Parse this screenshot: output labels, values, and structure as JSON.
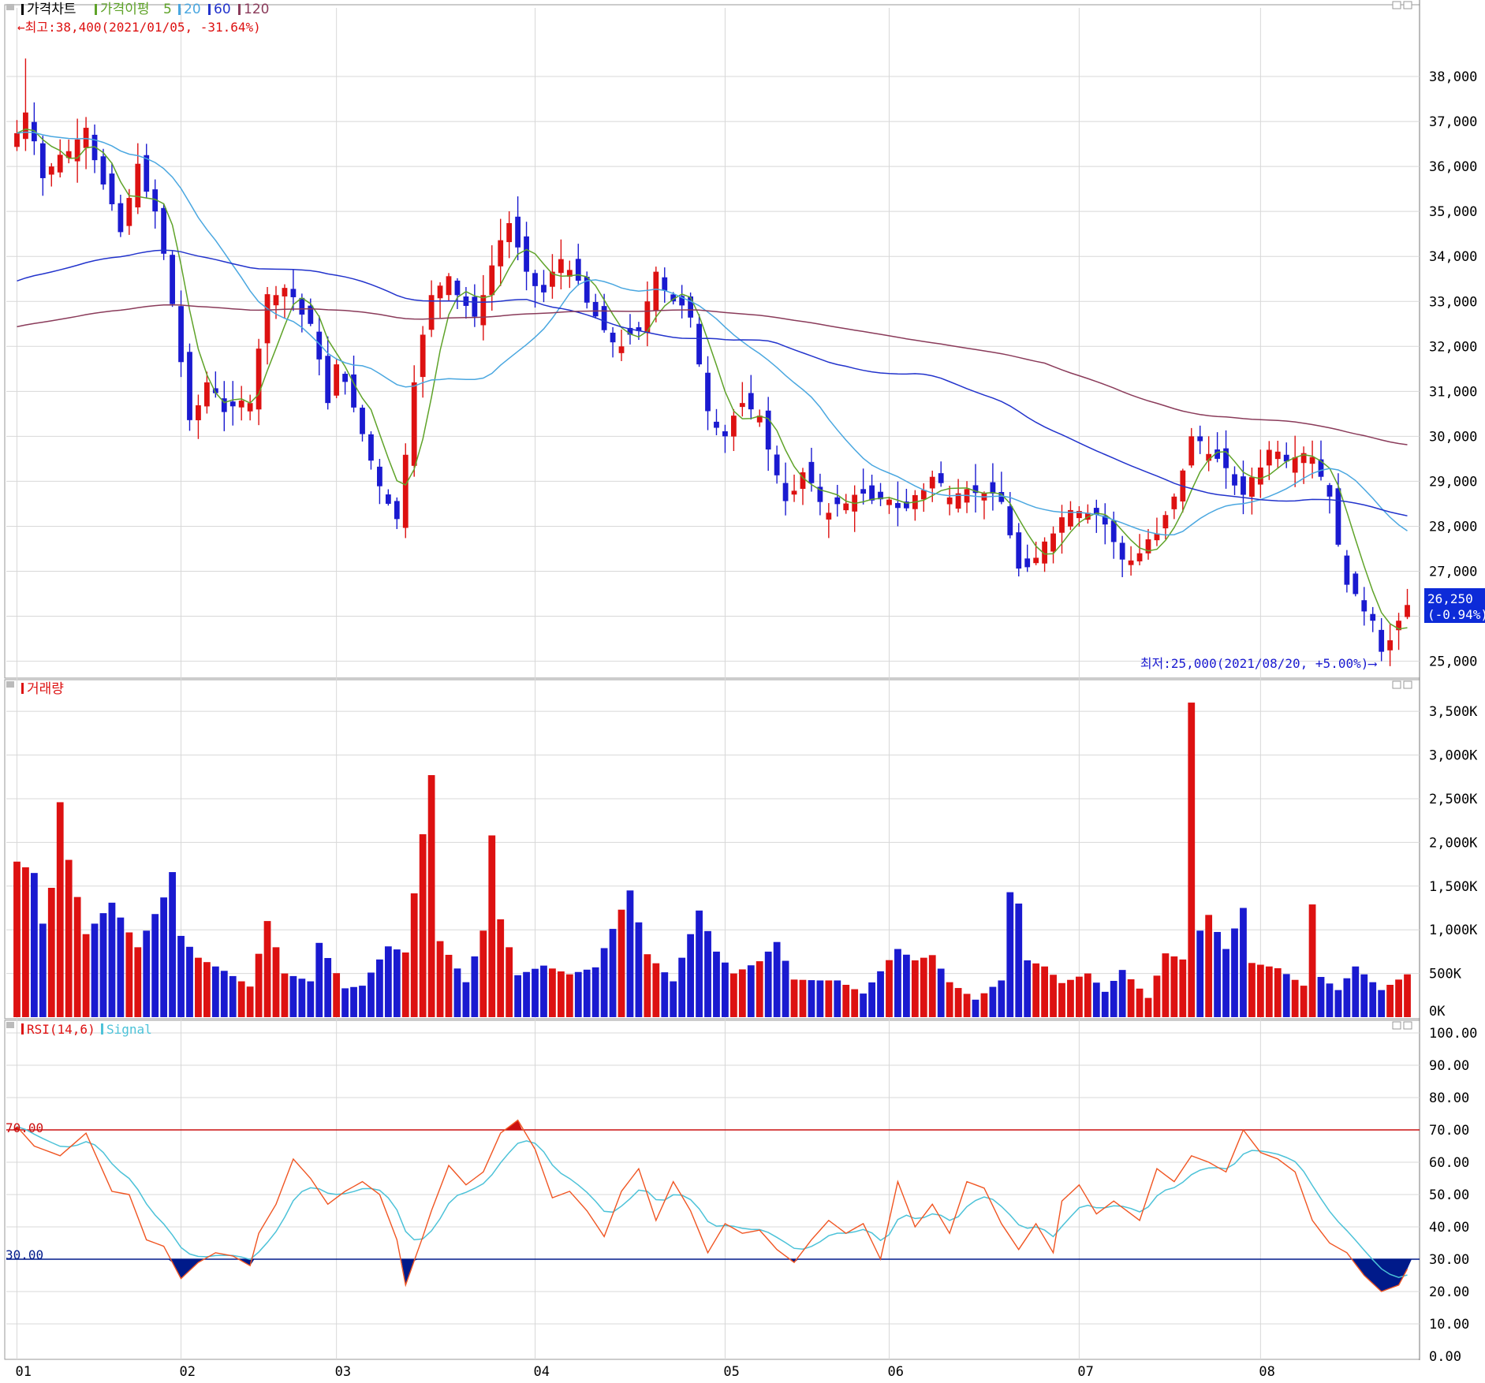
{
  "colors": {
    "up": "#dd1111",
    "down": "#1a1ad0",
    "ma5": "#5fa329",
    "ma20": "#4aa7e0",
    "ma60": "#2233cc",
    "ma120": "#8a3b5a",
    "rsi": "#f05522",
    "signal": "#4cc2d8",
    "grid": "#d8d8d8",
    "ob": "#cc1111",
    "os": "#001a8a"
  },
  "price_panel": {
    "legend": {
      "title": "가격차트",
      "ma_label": "가격이평",
      "ma5": "5",
      "ma20": "20",
      "ma60": "60",
      "ma120": "120"
    },
    "high_note": "←최고:38,400(2021/01/05, -31.64%)",
    "low_note": "최저:25,000(2021/08/20, +5.00%)⟶",
    "last_price": "26,250",
    "last_change": "(-0.94%)",
    "y_ticks": [
      "38,000",
      "37,000",
      "36,000",
      "35,000",
      "34,000",
      "33,000",
      "32,000",
      "31,000",
      "30,000",
      "29,000",
      "28,000",
      "27,000",
      "25,000"
    ]
  },
  "volume_panel": {
    "legend": "거래량",
    "y_ticks": [
      "3,500K",
      "3,000K",
      "2,500K",
      "2,000K",
      "1,500K",
      "1,000K",
      "500K",
      "0K"
    ]
  },
  "rsi_panel": {
    "legend_rsi": "RSI(14,6)",
    "legend_signal": "Signal",
    "label_70": "70.00",
    "label_30": "30.00",
    "y_ticks": [
      "100.00",
      "90.00",
      "80.00",
      "70.00",
      "60.00",
      "50.00",
      "40.00",
      "30.00",
      "20.00",
      "10.00",
      "0.00"
    ]
  },
  "x_ticks": [
    "01",
    "02",
    "03",
    "04",
    "05",
    "06",
    "07",
    "08"
  ],
  "chart_data": {
    "type": "candlestick",
    "start_date": "2021-01-04",
    "n_bars": 162,
    "month_start_index": [
      0,
      19,
      37,
      60,
      82,
      101,
      123,
      144
    ],
    "highest": {
      "value": 38400,
      "date": "2021/01/05",
      "pct": "-31.64%"
    },
    "lowest": {
      "value": 25000,
      "date": "2021/08/20",
      "pct": "+5.00%"
    },
    "last_close": 26250,
    "price_ylim": [
      24800,
      39000
    ],
    "volume_ylim": [
      0,
      3700000
    ],
    "rsi_ylim": [
      0,
      100
    ],
    "rsi_levels": [
      70,
      30
    ],
    "close_keypoints": [
      [
        0,
        36800
      ],
      [
        1,
        37200
      ],
      [
        3,
        35800
      ],
      [
        6,
        36400
      ],
      [
        8,
        36800
      ],
      [
        10,
        35600
      ],
      [
        12,
        34600
      ],
      [
        14,
        36000
      ],
      [
        16,
        35000
      ],
      [
        18,
        33000
      ],
      [
        20,
        30300
      ],
      [
        22,
        31200
      ],
      [
        24,
        30600
      ],
      [
        27,
        30800
      ],
      [
        29,
        33100
      ],
      [
        31,
        33300
      ],
      [
        34,
        32500
      ],
      [
        36,
        30800
      ],
      [
        37,
        31600
      ],
      [
        39,
        30700
      ],
      [
        41,
        29400
      ],
      [
        43,
        28500
      ],
      [
        44,
        28100
      ],
      [
        46,
        31200
      ],
      [
        48,
        33200
      ],
      [
        50,
        33500
      ],
      [
        53,
        32600
      ],
      [
        55,
        33800
      ],
      [
        57,
        34800
      ],
      [
        59,
        33600
      ],
      [
        61,
        33200
      ],
      [
        63,
        34000
      ],
      [
        65,
        33400
      ],
      [
        68,
        32300
      ],
      [
        70,
        32000
      ],
      [
        72,
        32400
      ],
      [
        74,
        33600
      ],
      [
        76,
        33000
      ],
      [
        78,
        32700
      ],
      [
        80,
        30500
      ],
      [
        82,
        30000
      ],
      [
        84,
        30800
      ],
      [
        86,
        30400
      ],
      [
        89,
        28500
      ],
      [
        91,
        29200
      ],
      [
        94,
        28300
      ],
      [
        97,
        28700
      ],
      [
        100,
        28600
      ],
      [
        103,
        28400
      ],
      [
        106,
        29100
      ],
      [
        108,
        28700
      ],
      [
        111,
        28800
      ],
      [
        114,
        28600
      ],
      [
        116,
        27000
      ],
      [
        118,
        27300
      ],
      [
        121,
        28200
      ],
      [
        123,
        28400
      ],
      [
        126,
        28100
      ],
      [
        128,
        27200
      ],
      [
        130,
        27400
      ],
      [
        132,
        27900
      ],
      [
        134,
        28600
      ],
      [
        136,
        30000
      ],
      [
        139,
        29500
      ],
      [
        142,
        28700
      ],
      [
        145,
        29700
      ],
      [
        147,
        29500
      ],
      [
        150,
        29600
      ],
      [
        152,
        28600
      ],
      [
        154,
        26700
      ],
      [
        157,
        25900
      ],
      [
        158,
        25150
      ],
      [
        160,
        25900
      ],
      [
        161,
        26250
      ]
    ],
    "volume_keypoints": [
      [
        0,
        1780000
      ],
      [
        2,
        1650000
      ],
      [
        3,
        1070000
      ],
      [
        4,
        1480000
      ],
      [
        5,
        2460000
      ],
      [
        6,
        1800000
      ],
      [
        8,
        950000
      ],
      [
        11,
        1310000
      ],
      [
        14,
        800000
      ],
      [
        17,
        1370000
      ],
      [
        18,
        1660000
      ],
      [
        19,
        930000
      ],
      [
        21,
        680000
      ],
      [
        24,
        530000
      ],
      [
        27,
        350000
      ],
      [
        29,
        1100000
      ],
      [
        31,
        500000
      ],
      [
        34,
        410000
      ],
      [
        35,
        850000
      ],
      [
        38,
        330000
      ],
      [
        40,
        360000
      ],
      [
        43,
        810000
      ],
      [
        45,
        740000
      ],
      [
        48,
        2770000
      ],
      [
        49,
        870000
      ],
      [
        52,
        400000
      ],
      [
        54,
        990000
      ],
      [
        55,
        2080000
      ],
      [
        56,
        1120000
      ],
      [
        58,
        480000
      ],
      [
        61,
        590000
      ],
      [
        64,
        490000
      ],
      [
        67,
        570000
      ],
      [
        71,
        1450000
      ],
      [
        73,
        720000
      ],
      [
        76,
        410000
      ],
      [
        79,
        1220000
      ],
      [
        81,
        750000
      ],
      [
        83,
        500000
      ],
      [
        86,
        640000
      ],
      [
        88,
        860000
      ],
      [
        90,
        430000
      ],
      [
        93,
        420000
      ],
      [
        95,
        420000
      ],
      [
        98,
        270000
      ],
      [
        102,
        780000
      ],
      [
        104,
        650000
      ],
      [
        106,
        710000
      ],
      [
        108,
        400000
      ],
      [
        111,
        200000
      ],
      [
        114,
        420000
      ],
      [
        115,
        1430000
      ],
      [
        116,
        1300000
      ],
      [
        117,
        650000
      ],
      [
        119,
        580000
      ],
      [
        121,
        390000
      ],
      [
        124,
        500000
      ],
      [
        126,
        290000
      ],
      [
        128,
        540000
      ],
      [
        131,
        220000
      ],
      [
        133,
        730000
      ],
      [
        135,
        660000
      ],
      [
        136,
        3600000
      ],
      [
        137,
        990000
      ],
      [
        138,
        1170000
      ],
      [
        140,
        780000
      ],
      [
        142,
        1250000
      ],
      [
        143,
        620000
      ],
      [
        146,
        560000
      ],
      [
        149,
        360000
      ],
      [
        150,
        1290000
      ],
      [
        151,
        460000
      ],
      [
        153,
        310000
      ],
      [
        155,
        580000
      ],
      [
        158,
        310000
      ],
      [
        161,
        490000
      ]
    ],
    "rsi_keypoints": [
      [
        0,
        71
      ],
      [
        2,
        65
      ],
      [
        5,
        62
      ],
      [
        8,
        69
      ],
      [
        11,
        51
      ],
      [
        13,
        50
      ],
      [
        15,
        36
      ],
      [
        17,
        34
      ],
      [
        19,
        24
      ],
      [
        21,
        29
      ],
      [
        23,
        32
      ],
      [
        25,
        31
      ],
      [
        27,
        28
      ],
      [
        28,
        38
      ],
      [
        30,
        47
      ],
      [
        32,
        61
      ],
      [
        34,
        55
      ],
      [
        36,
        47
      ],
      [
        38,
        51
      ],
      [
        40,
        54
      ],
      [
        42,
        50
      ],
      [
        44,
        36
      ],
      [
        45,
        22
      ],
      [
        47,
        37
      ],
      [
        48,
        45
      ],
      [
        50,
        59
      ],
      [
        52,
        53
      ],
      [
        54,
        57
      ],
      [
        56,
        69
      ],
      [
        58,
        73
      ],
      [
        60,
        64
      ],
      [
        62,
        49
      ],
      [
        64,
        51
      ],
      [
        66,
        45
      ],
      [
        68,
        37
      ],
      [
        70,
        51
      ],
      [
        72,
        58
      ],
      [
        74,
        42
      ],
      [
        76,
        54
      ],
      [
        78,
        45
      ],
      [
        80,
        32
      ],
      [
        82,
        41
      ],
      [
        84,
        38
      ],
      [
        86,
        39
      ],
      [
        88,
        33
      ],
      [
        90,
        29
      ],
      [
        92,
        36
      ],
      [
        94,
        42
      ],
      [
        96,
        38
      ],
      [
        98,
        41
      ],
      [
        100,
        30
      ],
      [
        102,
        54
      ],
      [
        104,
        40
      ],
      [
        106,
        47
      ],
      [
        108,
        38
      ],
      [
        110,
        54
      ],
      [
        112,
        52
      ],
      [
        114,
        41
      ],
      [
        116,
        33
      ],
      [
        118,
        41
      ],
      [
        120,
        32
      ],
      [
        121,
        48
      ],
      [
        123,
        53
      ],
      [
        125,
        44
      ],
      [
        127,
        48
      ],
      [
        130,
        42
      ],
      [
        132,
        58
      ],
      [
        134,
        54
      ],
      [
        136,
        62
      ],
      [
        138,
        60
      ],
      [
        140,
        57
      ],
      [
        142,
        70
      ],
      [
        144,
        63
      ],
      [
        146,
        61
      ],
      [
        148,
        57
      ],
      [
        150,
        42
      ],
      [
        152,
        35
      ],
      [
        154,
        32
      ],
      [
        156,
        25
      ],
      [
        158,
        20
      ],
      [
        160,
        22
      ],
      [
        161,
        27
      ]
    ],
    "ma_seed": {
      "ma60": 33400,
      "ma120": 32400
    }
  }
}
